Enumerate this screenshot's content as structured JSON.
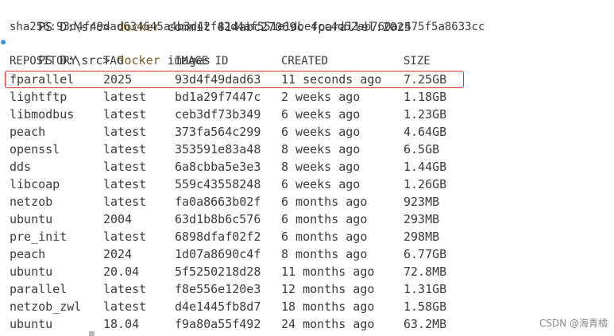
{
  "colors": {
    "background": "#ffffff",
    "text": "#3b3b3b",
    "command": "#795e26",
    "prompt_dot": "#3794ff",
    "highlight": "#e0302a",
    "watermark": "#8a8a8a"
  },
  "line1": {
    "prompt": "PS D:\\src> ",
    "command": "docker",
    "args": " commit 814abc27069c fparallel:2025"
  },
  "line2": {
    "output": "sha256:93d4f49dad634645a4b3d42f42d4af551e1dbe4cc4d52eb760ac475f5a8633cc"
  },
  "line3": {
    "prompt": "PS D:\\src> ",
    "command": "docker",
    "args": " images"
  },
  "table": {
    "headers": [
      "REPOSITORY",
      "TAG",
      "IMAGE ID",
      "CREATED",
      "SIZE"
    ],
    "rows": [
      [
        "fparallel",
        "2025",
        "93d4f49dad63",
        "11 seconds ago",
        "7.25GB"
      ],
      [
        "lightftp",
        "latest",
        "bd1a29f7447c",
        "2 weeks ago",
        "1.18GB"
      ],
      [
        "libmodbus",
        "latest",
        "ceb3df73b349",
        "6 weeks ago",
        "1.23GB"
      ],
      [
        "peach",
        "latest",
        "373fa564c299",
        "6 weeks ago",
        "4.64GB"
      ],
      [
        "openssl",
        "latest",
        "353591e83a48",
        "8 weeks ago",
        "6.5GB"
      ],
      [
        "dds",
        "latest",
        "6a8cbba5e3e3",
        "8 weeks ago",
        "1.44GB"
      ],
      [
        "libcoap",
        "latest",
        "559c43558248",
        "6 weeks ago",
        "1.26GB"
      ],
      [
        "netzob",
        "latest",
        "fa0a8663b02f",
        "6 months ago",
        "923MB"
      ],
      [
        "ubuntu",
        "2004",
        "63d1b8b6c576",
        "6 months ago",
        "293MB"
      ],
      [
        "pre_init",
        "latest",
        "6898dfaf02f2",
        "6 months ago",
        "298MB"
      ],
      [
        "peach",
        "2024",
        "1d07a8690c4f",
        "8 months ago",
        "6.77GB"
      ],
      [
        "ubuntu",
        "20.04",
        "5f5250218d28",
        "11 months ago",
        "72.8MB"
      ],
      [
        "parallel",
        "latest",
        "f8e556e120e3",
        "12 months ago",
        "1.31GB"
      ],
      [
        "netzob_zwl",
        "latest",
        "d4e1445fb8d7",
        "18 months ago",
        "1.58GB"
      ],
      [
        "ubuntu",
        "18.04",
        "f9a80a55f492",
        "24 months ago",
        "63.2MB"
      ]
    ]
  },
  "watermark": "CSDN @海青橘"
}
